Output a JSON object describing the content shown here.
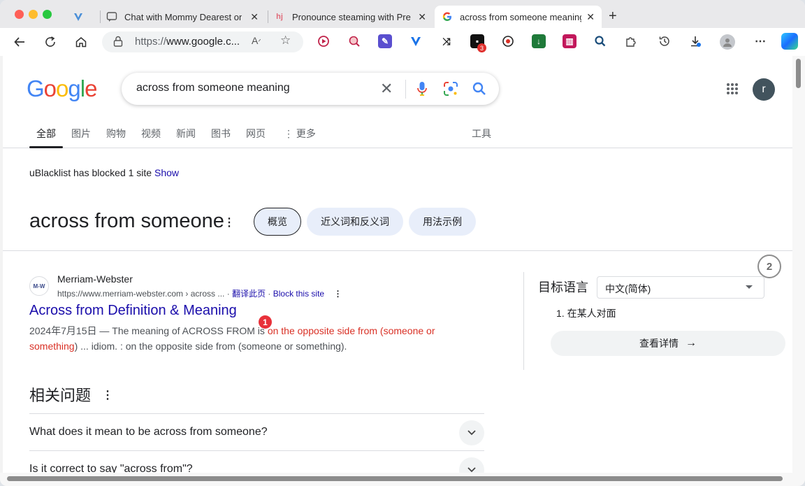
{
  "tabs": [
    {
      "title": "",
      "favicon": "vivaldi-v-icon"
    },
    {
      "title": "Chat with Mommy Dearest on",
      "favicon": "chat-bubble-icon"
    },
    {
      "title": "Pronounce steaming with Prec",
      "favicon": "hj-icon"
    },
    {
      "title": "across from someone meaning",
      "favicon": "google-g-icon"
    }
  ],
  "address_bar": {
    "url_prefix": "https://",
    "url_host": "www.google.c..."
  },
  "extension_badge": "3",
  "search": {
    "query": "across from someone meaning"
  },
  "avatar_letter": "r",
  "nav_tabs": [
    "全部",
    "图片",
    "购物",
    "视频",
    "新闻",
    "图书",
    "网页",
    "更多",
    "工具"
  ],
  "blocked": {
    "text": "uBlacklist has blocked 1 site",
    "link": "Show"
  },
  "dictionary": {
    "heading": "across from someone",
    "chips": [
      "概览",
      "近义词和反义词",
      "用法示例"
    ]
  },
  "result": {
    "site_name": "Merriam-Webster",
    "favicon_text": "M-W",
    "cite": "https://www.merriam-webster.com › across ...",
    "translate_link": "翻译此页",
    "block_link": "Block this site",
    "title": "Across from Definition & Meaning",
    "snippet_prefix": "2024年7月15日 — The meaning of ACROSS FROM is ",
    "snippet_highlight_1": "on the opposite side from (someone or",
    "snippet_highlight_2": "something",
    "snippet_suffix": ") ... idiom. : on the opposite side from (someone or something)."
  },
  "markers": {
    "m1": "1",
    "m2": "2"
  },
  "related": {
    "title": "相关问题",
    "questions": [
      "What does it mean to be across from someone?",
      "Is it correct to say \"across from\"?"
    ]
  },
  "translate_panel": {
    "label": "目标语言",
    "language": "中文(简体)",
    "translation": "1. 在某人对面",
    "details_button": "查看详情"
  }
}
